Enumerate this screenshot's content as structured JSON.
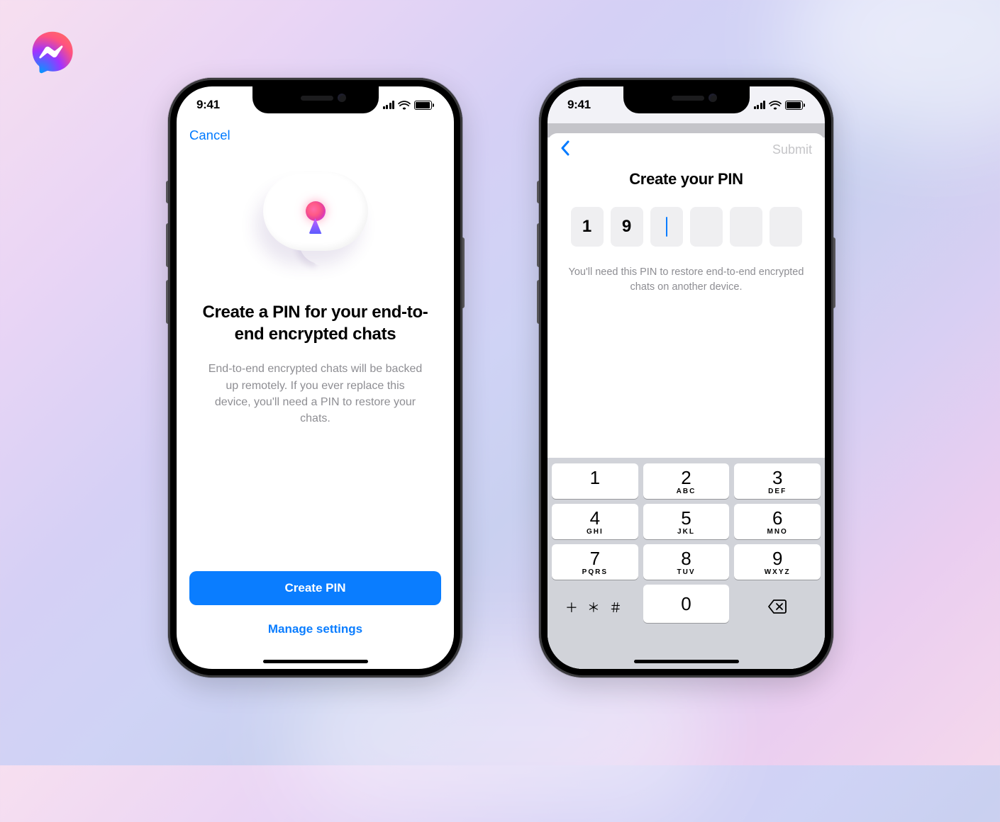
{
  "overlay_logo": "messenger-icon",
  "status_time": "9:41",
  "left": {
    "cancel": "Cancel",
    "headline": "Create a PIN for your end-to-end encrypted chats",
    "description": "End-to-end encrypted chats will be backed up remotely. If you ever replace this device, you'll need a PIN to restore your chats.",
    "primary_button": "Create PIN",
    "secondary_link": "Manage settings"
  },
  "right": {
    "back_icon": "chevron-left",
    "submit": "Submit",
    "headline": "Create your PIN",
    "pin_digits": [
      "1",
      "9",
      "",
      "",
      "",
      ""
    ],
    "hint": "You'll need this PIN to restore end-to-end encrypted chats on another device.",
    "symbols": "＋ ＊ ＃"
  },
  "keypad": [
    [
      {
        "num": "1",
        "label": ""
      },
      {
        "num": "2",
        "label": "ABC"
      },
      {
        "num": "3",
        "label": "DEF"
      }
    ],
    [
      {
        "num": "4",
        "label": "GHI"
      },
      {
        "num": "5",
        "label": "JKL"
      },
      {
        "num": "6",
        "label": "MNO"
      }
    ],
    [
      {
        "num": "7",
        "label": "PQRS"
      },
      {
        "num": "8",
        "label": "TUV"
      },
      {
        "num": "9",
        "label": "WXYZ"
      }
    ]
  ],
  "keypad_zero": "0"
}
